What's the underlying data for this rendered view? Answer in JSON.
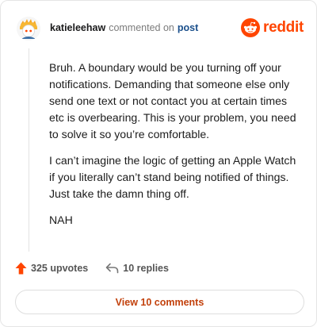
{
  "comment": {
    "username": "katieleehaw",
    "action": "commented on",
    "target": "post",
    "paragraphs": [
      "Bruh. A boundary would be you turning off your notifications. Demanding that someone else only send one text or not contact you at certain times etc is overbearing. This is your problem, you need to solve it so you’re comfortable.",
      "I can’t imagine the logic of getting an Apple Watch if you literally can’t stand being notified of things. Just take the damn thing off.",
      "NAH"
    ]
  },
  "brand": {
    "name": "reddit",
    "color": "#ff4500"
  },
  "actions": {
    "upvotes": "325 upvotes",
    "replies": "10 replies"
  },
  "footer": {
    "view_label": "View 10 comments"
  },
  "icons": {
    "upvote": "upvote-arrow-icon",
    "reply": "reply-arrow-icon",
    "logo": "reddit-snoo-icon"
  }
}
